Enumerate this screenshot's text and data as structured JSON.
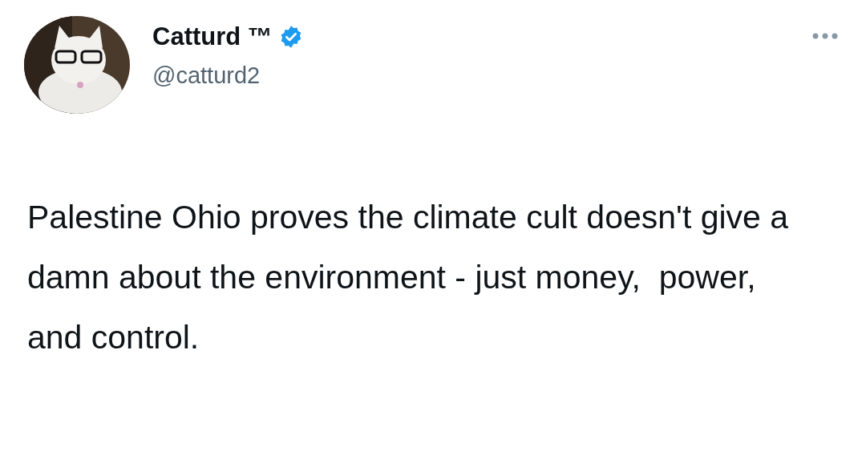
{
  "author": {
    "name": "Catturd ™",
    "verified": true,
    "handle": "@catturd2"
  },
  "tweet": {
    "text": "Palestine Ohio proves the climate cult doesn't give a damn about the environment - just money,  power, and control."
  }
}
